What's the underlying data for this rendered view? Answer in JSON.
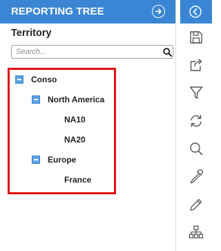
{
  "panel": {
    "title": "REPORTING TREE",
    "section_title": "Territory",
    "search": {
      "placeholder": "Search...",
      "value": ""
    },
    "tree": [
      {
        "label": "Conso",
        "expanded": true,
        "level": 0
      },
      {
        "label": "North America",
        "expanded": true,
        "level": 1
      },
      {
        "label": "NA10",
        "level": 2
      },
      {
        "label": "NA20",
        "level": 2
      },
      {
        "label": "Europe",
        "expanded": true,
        "level": 1
      },
      {
        "label": "France",
        "level": 2
      }
    ]
  },
  "toolbar": {
    "tools": [
      "collapse-panel",
      "save",
      "export",
      "filter",
      "refresh",
      "search",
      "color-picker",
      "edit",
      "hierarchy"
    ]
  },
  "colors": {
    "accent": "#3a86d4",
    "highlight_border": "#e10d12",
    "toggle": "#5aa2e4"
  }
}
